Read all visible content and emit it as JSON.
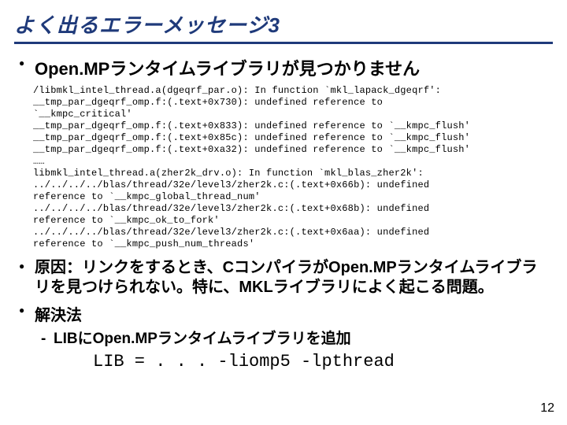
{
  "title": "よく出るエラーメッセージ3",
  "bullet1": "Open.MPランタイムライブラリが見つかりません",
  "code": "/libmkl_intel_thread.a(dgeqrf_par.o): In function `mkl_lapack_dgeqrf':\n__tmp_par_dgeqrf_omp.f:(.text+0x730): undefined reference to\n`__kmpc_critical'\n__tmp_par_dgeqrf_omp.f:(.text+0x833): undefined reference to `__kmpc_flush'\n__tmp_par_dgeqrf_omp.f:(.text+0x85c): undefined reference to `__kmpc_flush'\n__tmp_par_dgeqrf_omp.f:(.text+0xa32): undefined reference to `__kmpc_flush'\n……\nlibmkl_intel_thread.a(zher2k_drv.o): In function `mkl_blas_zher2k':\n../../../../blas/thread/32e/level3/zher2k.c:(.text+0x66b): undefined\nreference to `__kmpc_global_thread_num'\n../../../../blas/thread/32e/level3/zher2k.c:(.text+0x68b): undefined\nreference to `__kmpc_ok_to_fork'\n../../../../blas/thread/32e/level3/zher2k.c:(.text+0x6aa): undefined\nreference to `__kmpc_push_num_threads'",
  "bullet2": "原因：リンクをするとき、CコンパイラがOpen.MPランタイムライブラリを見つけられない。特に、MKLライブラリによく起こる問題。",
  "bullet3": "解決法",
  "sub1": "LIBにOpen.MPランタイムライブラリを追加",
  "cmd": "LIB = . . . -liomp5 -lpthread",
  "pageNumber": "12"
}
